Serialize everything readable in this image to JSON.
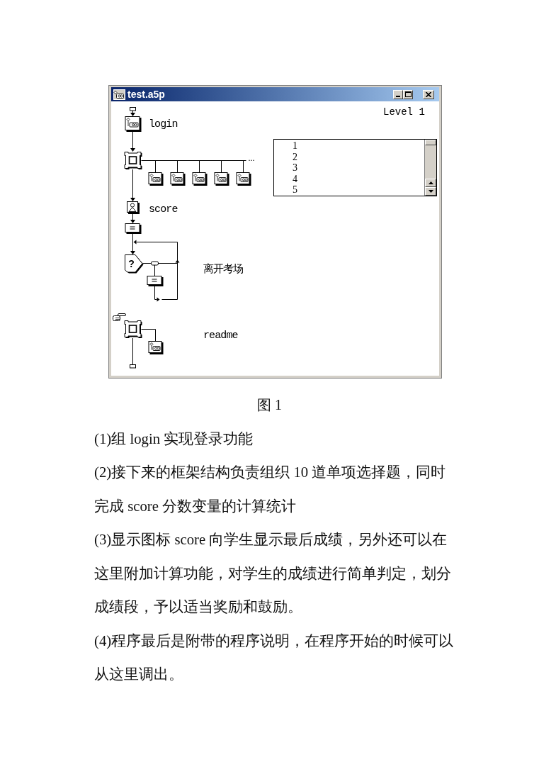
{
  "window": {
    "title": "test.a5p",
    "level_label": "Level 1"
  },
  "flowline": [
    {
      "kind": "group",
      "label": "login",
      "paste_point": false
    },
    {
      "kind": "framework",
      "pages": [
        {
          "kind": "group"
        },
        {
          "kind": "group"
        },
        {
          "kind": "group"
        },
        {
          "kind": "group"
        },
        {
          "kind": "group"
        }
      ],
      "more": "...",
      "paste_point": false
    },
    {
      "kind": "display",
      "label": "score",
      "paste_point": false
    },
    {
      "kind": "calculation",
      "paste_point": false
    },
    {
      "kind": "interaction_loop",
      "symbol": "?",
      "label": "离开考场",
      "responses": [
        {
          "kind": "calculation"
        }
      ],
      "paste_point": false
    },
    {
      "kind": "framework",
      "label": "readme",
      "pages": [
        {
          "kind": "group"
        }
      ],
      "paste_point": true
    }
  ],
  "list_box": {
    "lines": [
      "1",
      "2",
      "3",
      "4",
      "5"
    ]
  },
  "caption": "图 1",
  "paragraphs": [
    "(1)组 login 实现登录功能",
    "(2)接下来的框架结构负责组织 10 道单项选择题，同时完成 score 分数变量的计算统计",
    "(3)显示图标 score 向学生显示最后成绩，另外还可以在这里附加计算功能，对学生的成绩进行简单判定，划分成绩段，予以适当奖励和鼓励。",
    "(4)程序最后是附带的程序说明，在程序开始的时候可以从这里调出。"
  ]
}
